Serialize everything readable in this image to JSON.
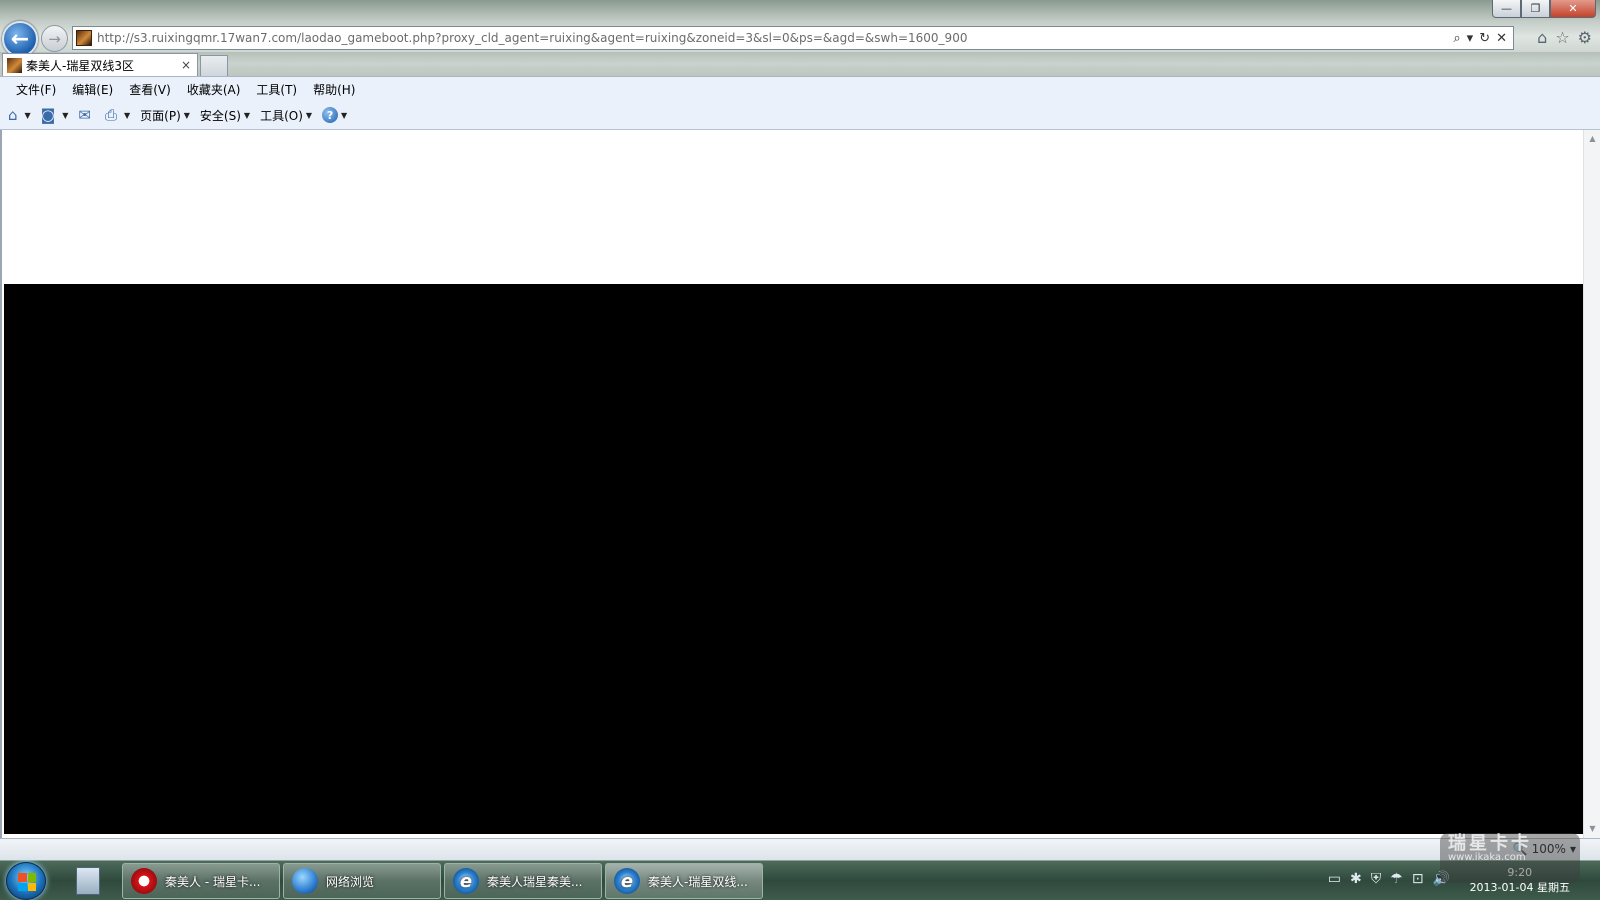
{
  "window": {
    "min_glyph": "—",
    "restore_glyph": "❐",
    "close_glyph": "✕"
  },
  "nav": {
    "back_glyph": "←",
    "forward_glyph": "→"
  },
  "address": {
    "url": "http://s3.ruixingqmr.17wan7.com/laodao_gameboot.php?proxy_cld_agent=ruixing&agent=ruixing&zoneid=3&sl=0&ps=&agd=&swh=1600_900",
    "search_glyph": "⌕",
    "dropdown_glyph": "▾",
    "refresh_glyph": "↻",
    "stop_glyph": "✕"
  },
  "right_nav": {
    "home_glyph": "⌂",
    "favorites_glyph": "☆",
    "tools_glyph": "⚙"
  },
  "tabs": [
    {
      "title": "秦美人-瑞星双线3区",
      "close_glyph": "×"
    }
  ],
  "menu": [
    "文件(F)",
    "编辑(E)",
    "查看(V)",
    "收藏夹(A)",
    "工具(T)",
    "帮助(H)"
  ],
  "command_bar": {
    "home_glyph": "⌂",
    "feeds_glyph": "◙",
    "mail_glyph": "✉",
    "print_glyph": "⎙",
    "drop_glyph": "▼",
    "page_label": "页面(P)",
    "safety_label": "安全(S)",
    "tools_label": "工具(O)",
    "help_glyph": "?"
  },
  "scrollbar": {
    "up_glyph": "▲",
    "down_glyph": "▼"
  },
  "status": {
    "zoom": "100%",
    "zoom_glyph": "🔍",
    "zoom_drop": "▾"
  },
  "taskbar": {
    "items": [
      {
        "label": "秦美人 - 瑞星卡...",
        "icon": "opera-icon"
      },
      {
        "label": "网络浏览",
        "icon": "globe-icon"
      },
      {
        "label": "秦美人瑞星秦美...",
        "icon": "ie-icon"
      },
      {
        "label": "秦美人-瑞星双线...",
        "icon": "ie-icon"
      }
    ],
    "ie_glyph": "e",
    "tray_glyphs": [
      "▭",
      "✱",
      "⛨",
      "☂",
      "⊡",
      "🔊"
    ]
  },
  "clock": {
    "time": "9:20",
    "date": "2013-01-04 星期五"
  },
  "watermark": {
    "brand": "瑞星卡卡",
    "site": "www.ikaka.com"
  }
}
